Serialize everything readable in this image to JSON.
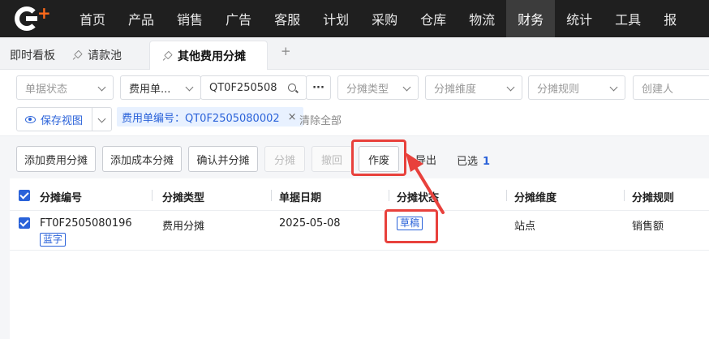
{
  "nav": {
    "items": [
      "首页",
      "产品",
      "销售",
      "广告",
      "客服",
      "计划",
      "采购",
      "仓库",
      "物流",
      "财务",
      "统计",
      "工具",
      "报"
    ],
    "active_index": 9
  },
  "tabs": {
    "items": [
      {
        "label": "即时看板",
        "pinned": false
      },
      {
        "label": "请款池",
        "pinned": true
      },
      {
        "label": "其他费用分摊",
        "pinned": true,
        "active": true
      }
    ],
    "add_label": "+"
  },
  "filters": {
    "doc_status_placeholder": "单据状态",
    "fee_type_label": "费用单...",
    "fee_no_value": "QT0F250508",
    "more_label": "···",
    "alloc_type_placeholder": "分摊类型",
    "alloc_dim_placeholder": "分摊维度",
    "alloc_rule_placeholder": "分摊规则",
    "creator_placeholder": "创建人",
    "save_view_label": "保存视图",
    "chip_label": "费用单编号：QT0F2505080002",
    "chip_close": "×",
    "clear_all_label": "清除全部"
  },
  "toolbar": {
    "add_fee_alloc": "添加费用分摊",
    "add_cost_alloc": "添加成本分摊",
    "confirm_alloc": "确认并分摊",
    "alloc": "分摊",
    "withdraw": "撤回",
    "void": "作废",
    "export": "导出",
    "selected_label": "已选",
    "selected_count": "1"
  },
  "table": {
    "headers": [
      "分摊编号",
      "分摊类型",
      "单据日期",
      "分摊状态",
      "分摊维度",
      "分摊规则"
    ],
    "rows": [
      {
        "id": "FT0F2505080196",
        "id_tag": "蓝字",
        "type": "费用分摊",
        "date": "2025-05-08",
        "status": "草稿",
        "dimension": "站点",
        "rule": "销售额"
      }
    ]
  },
  "colors": {
    "accent": "#2a62d9",
    "annotation": "#e8413c",
    "nav_bg": "#1f1f1f"
  }
}
